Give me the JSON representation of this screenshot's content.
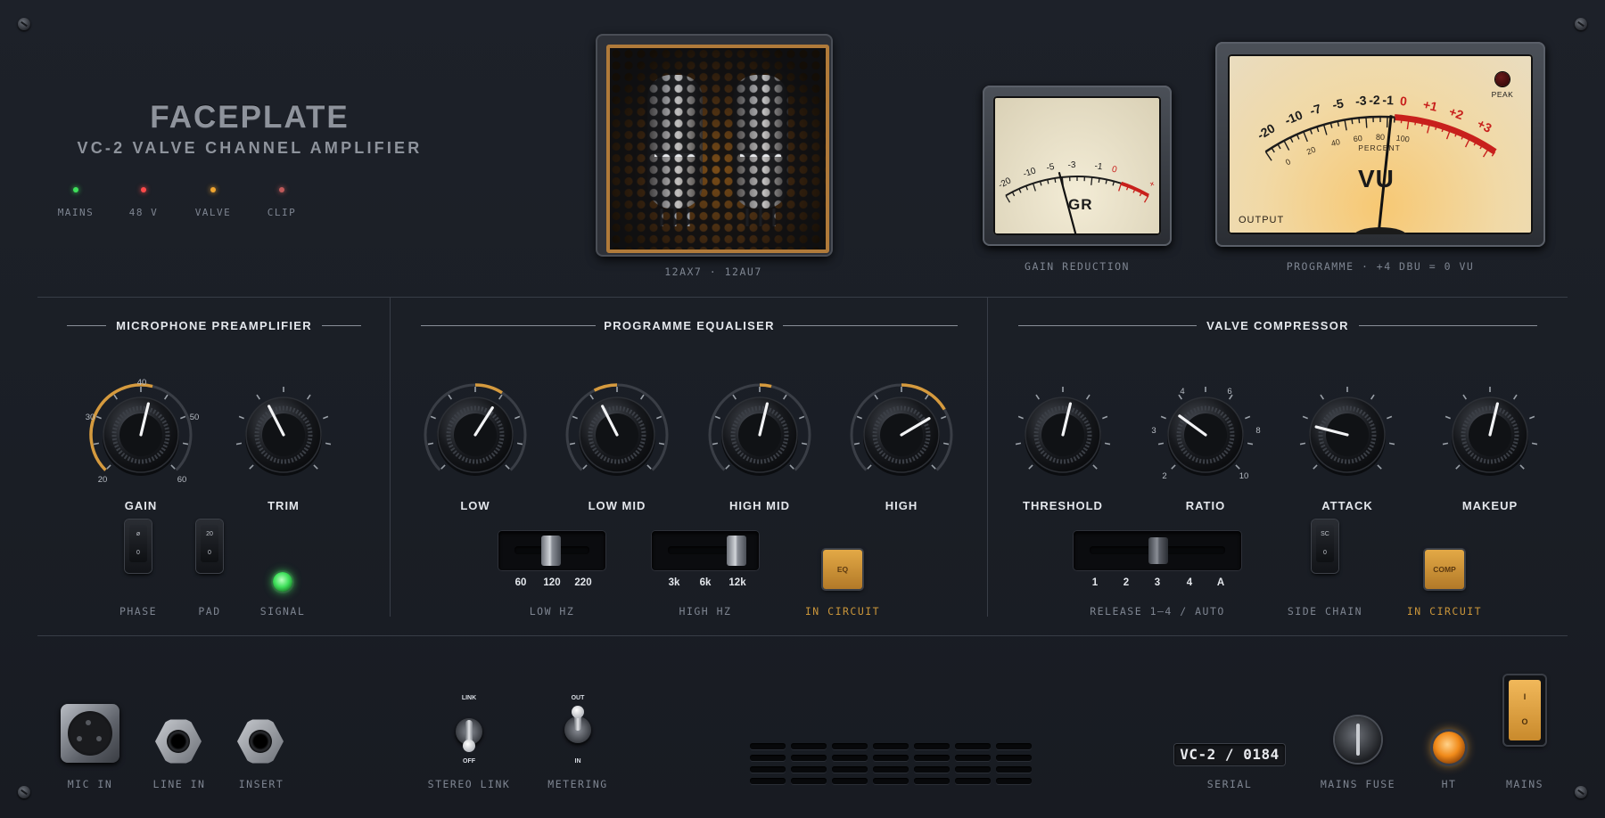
{
  "brand": {
    "title": "FACEPLATE",
    "subtitle": "VC-2 VALVE CHANNEL AMPLIFIER"
  },
  "status_leds": [
    {
      "label": "MAINS",
      "color": "#3ee05a"
    },
    {
      "label": "48 V",
      "color": "#ff4a4a"
    },
    {
      "label": "VALVE",
      "color": "#f0a530"
    },
    {
      "label": "CLIP",
      "color": "#c05a5a"
    }
  ],
  "tube_window": {
    "caption": "12AX7 · 12AU7"
  },
  "gr_meter": {
    "face_label": "GR",
    "scale": [
      "-20",
      "-10",
      "-5",
      "-3",
      "-1",
      "0",
      "+"
    ],
    "caption": "GAIN REDUCTION"
  },
  "vu_meter": {
    "face_label": "VU",
    "peak_label": "PEAK",
    "output_label": "OUTPUT",
    "percent_label": "PERCENT",
    "db_scale": [
      "-20",
      "-10",
      "-7",
      "-5",
      "-3",
      "-2",
      "-1",
      "0",
      "+1",
      "+2",
      "+3"
    ],
    "pct_scale": [
      "0",
      "20",
      "40",
      "60",
      "80",
      "100"
    ],
    "caption": "PROGRAMME · +4 DBU = 0 VU"
  },
  "sections": {
    "preamp": "MICROPHONE PREAMPLIFIER",
    "eq": "PROGRAMME EQUALISER",
    "comp": "VALVE COMPRESSOR"
  },
  "preamp": {
    "gain": {
      "label": "GAIN",
      "scale": [
        "20",
        "30",
        "40",
        "50",
        "60"
      ],
      "level": 0.55
    },
    "trim": {
      "label": "TRIM",
      "level": 0.4
    },
    "phase": {
      "cap_top": "ø",
      "cap_bottom": "0",
      "caption": "PHASE"
    },
    "pad": {
      "cap_top": "20",
      "cap_bottom": "0",
      "caption": "PAD"
    },
    "signal": {
      "caption": "SIGNAL",
      "color": "#3ee05a"
    }
  },
  "eq": {
    "knobs": [
      {
        "label": "LOW",
        "level": 0.62
      },
      {
        "label": "LOW MID",
        "level": 0.4
      },
      {
        "label": "HIGH MID",
        "level": 0.55
      },
      {
        "label": "HIGH",
        "level": 0.72
      }
    ],
    "low_hz": {
      "options": [
        "60",
        "120",
        "220"
      ],
      "selected": "120",
      "caption": "LOW HZ"
    },
    "high_hz": {
      "options": [
        "3k",
        "6k",
        "12k"
      ],
      "selected": "12k",
      "caption": "HIGH HZ"
    },
    "in_circuit": {
      "button_label": "EQ",
      "caption": "IN CIRCUIT"
    }
  },
  "comp": {
    "knobs": [
      {
        "label": "THRESHOLD",
        "level": 0.55
      },
      {
        "label": "RATIO",
        "level": 0.3,
        "scale": [
          "2",
          "3",
          "4",
          "6",
          "8",
          "10"
        ]
      },
      {
        "label": "ATTACK",
        "level": 0.22
      },
      {
        "label": "MAKEUP",
        "level": 0.55
      }
    ],
    "release": {
      "options": [
        "1",
        "2",
        "3",
        "4",
        "A"
      ],
      "selected": "3",
      "caption": "RELEASE 1–4 / AUTO"
    },
    "side_chain": {
      "cap_top": "SC",
      "cap_bottom": "0",
      "caption": "SIDE CHAIN"
    },
    "in_circuit": {
      "button_label": "COMP",
      "caption": "IN CIRCUIT"
    }
  },
  "rear": {
    "mic_in": "MIC IN",
    "line_in": "LINE IN",
    "insert": "INSERT",
    "stereo_link": {
      "top": "LINK",
      "bottom": "OFF",
      "caption": "STEREO LINK"
    },
    "metering": {
      "top": "OUT",
      "bottom": "IN",
      "caption": "METERING"
    },
    "serial": {
      "value": "VC-2 / 0184",
      "caption": "SERIAL"
    },
    "mains_fuse": "MAINS FUSE",
    "ht": "HT",
    "mains": {
      "on": "I",
      "off": "O",
      "caption": "MAINS"
    }
  }
}
